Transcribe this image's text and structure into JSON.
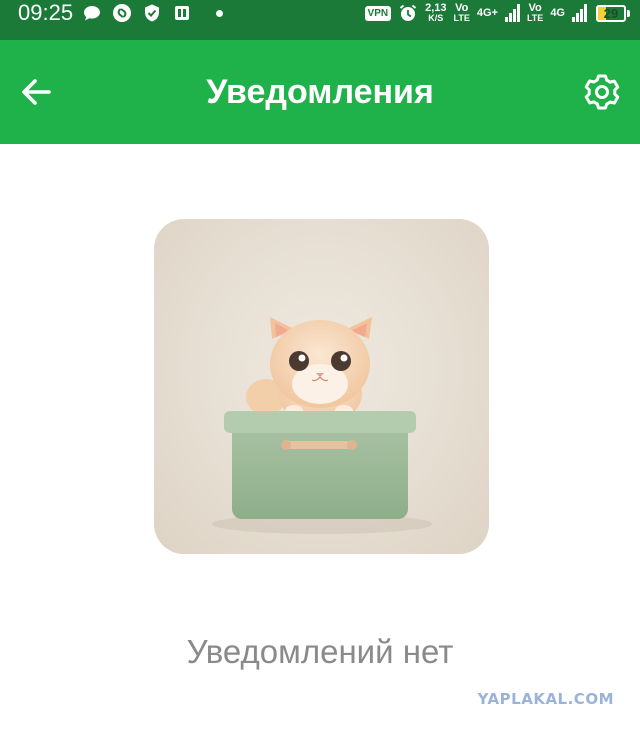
{
  "status_bar": {
    "time": "09:25",
    "vpn": "VPN",
    "speed_value": "2,13",
    "speed_unit": "K/S",
    "sim1_top": "Vo",
    "sim1_bottom": "LTE",
    "net1": "4G+",
    "sim2_top": "Vo",
    "sim2_bottom": "LTE",
    "net2": "4G",
    "battery_level": "29",
    "battery_fraction": 0.29,
    "icons": [
      "chat-bubble-icon",
      "shazam-icon",
      "shield-check-icon",
      "office-icon",
      "notification-dot",
      "alarm-icon"
    ]
  },
  "app_bar": {
    "title": "Уведомления",
    "back_icon": "arrow-left-icon",
    "settings_icon": "gear-icon",
    "background": "#20b24a"
  },
  "main": {
    "empty_message": "Уведомлений нет",
    "illustration": "cat-in-box-illustration"
  },
  "watermark": {
    "text": "YAPLAKAL.COM"
  },
  "colors": {
    "status_bar": "#1c7a38",
    "accent": "#20b24a",
    "empty_text": "#8a8a8a"
  }
}
